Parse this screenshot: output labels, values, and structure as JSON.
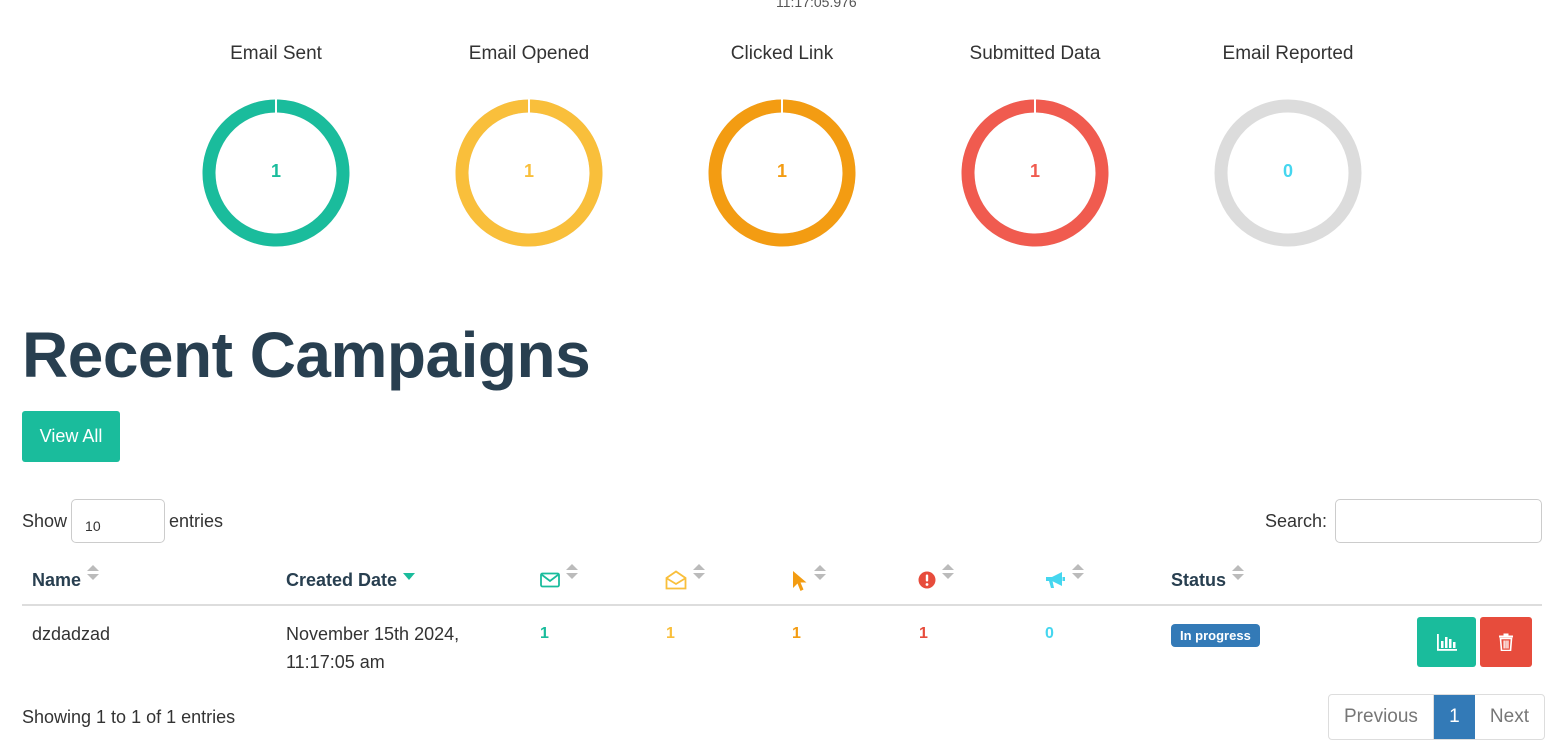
{
  "timestamp": "11:17:05.976",
  "stats": [
    {
      "title": "Email Sent",
      "value": "1",
      "color": "#1abc9c",
      "fill": 1.0
    },
    {
      "title": "Email Opened",
      "value": "1",
      "color": "#f9bf3b",
      "fill": 1.0
    },
    {
      "title": "Clicked Link",
      "value": "1",
      "color": "#f39c12",
      "fill": 1.0
    },
    {
      "title": "Submitted Data",
      "value": "1",
      "color": "#f05b4f",
      "fill": 1.0
    },
    {
      "title": "Email Reported",
      "value": "0",
      "color": "#45d6ef",
      "fill": 0.0
    }
  ],
  "section_title": "Recent Campaigns",
  "view_all_label": "View All",
  "table_controls": {
    "show_label": "Show",
    "length_value": "10",
    "entries_label": "entries",
    "search_label": "Search:",
    "search_value": ""
  },
  "columns": {
    "name": "Name",
    "created": "Created Date",
    "status": "Status",
    "icons": [
      "envelope-icon",
      "envelope-open-icon",
      "mouse-pointer-icon",
      "exclamation-circle-icon",
      "bullhorn-icon"
    ]
  },
  "rows": [
    {
      "name": "dzdadzad",
      "created_line1": "November 15th 2024,",
      "created_line2": "11:17:05 am",
      "sent": "1",
      "opened": "1",
      "clicked": "1",
      "submitted": "1",
      "reported": "0",
      "status": "In progress"
    }
  ],
  "footer": {
    "info": "Showing 1 to 1 of 1 entries",
    "prev": "Previous",
    "page": "1",
    "next": "Next"
  },
  "colors": {
    "sent": "#1abc9c",
    "opened": "#f9bf3b",
    "clicked": "#f39c12",
    "submitted": "#e74c3c",
    "reported": "#45d6ef",
    "status_badge": "#337ab7"
  }
}
